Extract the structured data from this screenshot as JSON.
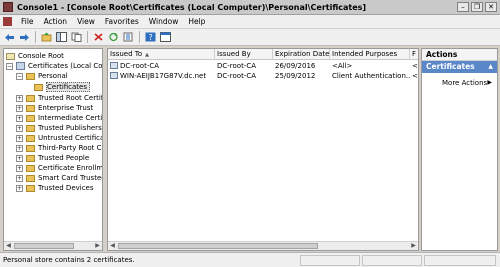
{
  "window": {
    "title": "Console1 - [Console Root\\Certificates (Local Computer)\\Personal\\Certificates]",
    "minimize": "–",
    "restore": "❐",
    "close": "✕"
  },
  "menu": [
    "File",
    "Action",
    "View",
    "Favorites",
    "Window",
    "Help"
  ],
  "toolbar": {
    "buttons": [
      "back-icon",
      "forward-icon",
      "up-folder-icon",
      "show-hide-tree-icon",
      "copy-icon",
      "delete-icon",
      "refresh-icon",
      "export-list-icon",
      "help-icon",
      "properties-icon"
    ]
  },
  "tree": {
    "root": "Console Root",
    "certificates": "Certificates (Local Com",
    "personal": "Personal",
    "personal_certificates": "Certificates",
    "stores": [
      "Trusted Root Certif",
      "Enterprise Trust",
      "Intermediate Certif",
      "Trusted Publishers",
      "Untrusted Certificat",
      "Third-Party Root C",
      "Trusted People",
      "Certificate Enrollme",
      "Smart Card Trusted",
      "Trusted Devices"
    ]
  },
  "list": {
    "columns": [
      "Issued To",
      "Issued By",
      "Expiration Date",
      "Intended Purposes",
      "F"
    ],
    "rows": [
      [
        "DC-root-CA",
        "DC-root-CA",
        "26/09/2016",
        "<All>",
        "<"
      ],
      [
        "WIN-AEIJB17G87V.dc.net",
        "DC-root-CA",
        "25/09/2012",
        "Client Authentication...",
        "<"
      ]
    ]
  },
  "actions": {
    "title": "Actions",
    "section": "Certificates",
    "more": "More Actions"
  },
  "status": "Personal store contains 2 certificates."
}
